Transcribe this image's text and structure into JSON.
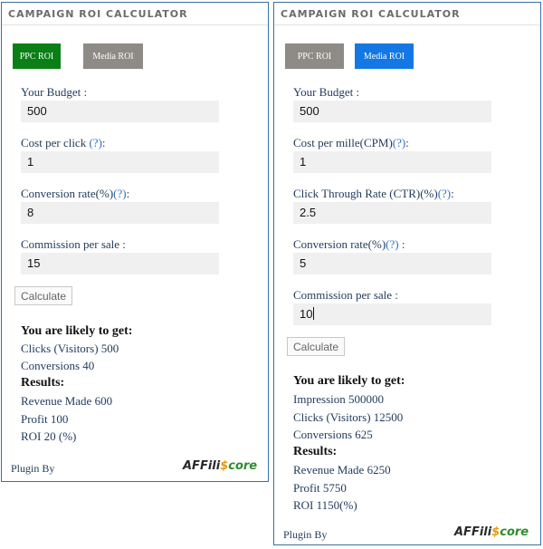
{
  "left_widget": {
    "title": "CAMPAIGN ROI CALCULATOR",
    "tabs": [
      {
        "label": "PPC ROI",
        "active": true
      },
      {
        "label": "Media ROI",
        "active": false
      }
    ],
    "fields": [
      {
        "label": "Your Budget :",
        "help": "",
        "value": "500"
      },
      {
        "label": "Cost per click ",
        "help": "(?)",
        "suffix": ":",
        "value": "1"
      },
      {
        "label": "Conversion rate(%)",
        "help": "(?)",
        "suffix": ":",
        "value": "8"
      },
      {
        "label": "Commission per sale :",
        "help": "",
        "value": "15"
      }
    ],
    "calculate_label": "Calculate",
    "likely_heading": "You are likely to get:",
    "lines": [
      "Clicks (Visitors) 500",
      "Conversions 40"
    ],
    "results_heading": "Results:",
    "results": [
      "Revenue Made 600",
      "Profit 100",
      "ROI 20 (%)"
    ],
    "plugin_by": "Plugin By"
  },
  "right_widget": {
    "title": "CAMPAIGN ROI CALCULATOR",
    "tabs": [
      {
        "label": "PPC ROI",
        "active": false
      },
      {
        "label": "Media ROI",
        "active": true
      }
    ],
    "fields": [
      {
        "label": "Your Budget :",
        "help": "",
        "value": "500"
      },
      {
        "label": "Cost per mille(CPM)",
        "help": "(?)",
        "suffix": ":",
        "value": "1"
      },
      {
        "label": "Click Through Rate (CTR)(%)",
        "help": "(?)",
        "suffix": ":",
        "value": "2.5"
      },
      {
        "label": "Conversion rate(%)",
        "help": "(?)",
        "suffix": " :",
        "value": "5"
      },
      {
        "label": "Commission per sale :",
        "help": "",
        "value": "10"
      }
    ],
    "calculate_label": "Calculate",
    "likely_heading": "You are likely to get:",
    "lines": [
      "Impression 500000",
      "Clicks (Visitors) 12500",
      "Conversions 625"
    ],
    "results_heading": "Results:",
    "results": [
      "Revenue Made 6250",
      "Profit 5750",
      "ROI 1150(%)"
    ],
    "plugin_by": "Plugin By"
  },
  "logo": {
    "part1": "AFFili",
    "mark": "$",
    "part2": "core"
  },
  "colors": {
    "active_green": "#0a7f15",
    "active_blue": "#1478e4",
    "inactive_gray": "#8e8a86",
    "border_blue": "#3b6fa3"
  }
}
